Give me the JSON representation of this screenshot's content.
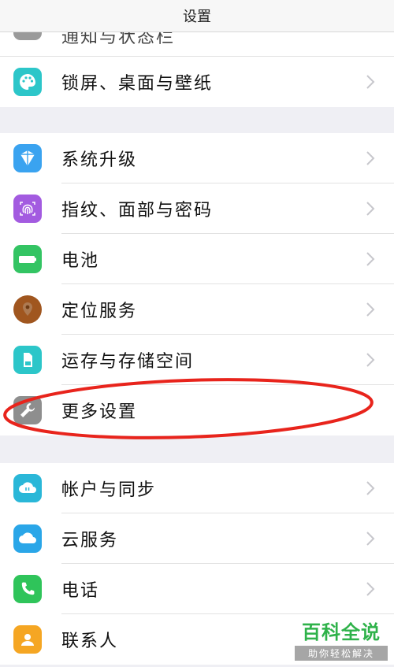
{
  "navbar": {
    "title": "设置"
  },
  "partial_row": {
    "label": "通知与状态栏",
    "icon": "notification-icon",
    "color": "#9a9a9a"
  },
  "group1": [
    {
      "label": "锁屏、桌面与壁纸",
      "icon": "palette-icon",
      "color": "#2cc6c9"
    }
  ],
  "group2": [
    {
      "label": "系统升级",
      "icon": "upgrade-box-icon",
      "color": "#3aa3f0"
    },
    {
      "label": "指纹、面部与密码",
      "icon": "fingerprint-icon",
      "color": "#a35be0"
    },
    {
      "label": "电池",
      "icon": "battery-icon",
      "color": "#33c463"
    },
    {
      "label": "定位服务",
      "icon": "location-icon",
      "color": "#a0561f"
    },
    {
      "label": "运存与存储空间",
      "icon": "storage-card-icon",
      "color": "#2cc6c9"
    },
    {
      "label": "更多设置",
      "icon": "wrench-icon",
      "color": "#8e8e8e"
    }
  ],
  "group3": [
    {
      "label": "帐户与同步",
      "icon": "cloud-sync-icon",
      "color": "#2ab7d8"
    },
    {
      "label": "云服务",
      "icon": "cloud-icon",
      "color": "#2aa6e8"
    },
    {
      "label": "电话",
      "icon": "phone-icon",
      "color": "#2fc45a"
    },
    {
      "label": "联系人",
      "icon": "contact-icon",
      "color": "#f5a623"
    }
  ],
  "annotation": {
    "color": "#e8241c"
  },
  "watermark": {
    "main": "百科全说",
    "sub": "助你轻松解决",
    "color": "#2fb24a"
  }
}
